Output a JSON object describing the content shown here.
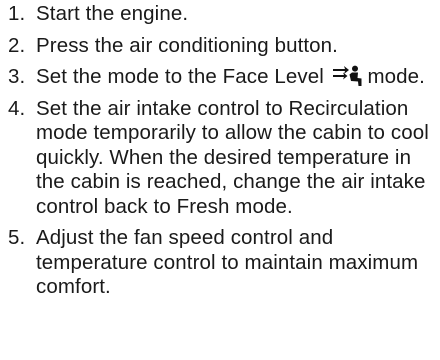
{
  "steps": [
    {
      "number": "1.",
      "text": "Start the engine."
    },
    {
      "number": "2.",
      "text": "Press the air conditioning button."
    },
    {
      "number": "3.",
      "text": "Set the mode to the Face Level",
      "text_after": "mode.",
      "icon": "face-level-mode-icon"
    },
    {
      "number": "4.",
      "text": "Set the air intake control to Recirculation mode temporarily to allow the cabin to cool quickly. When the desired temperature in the cabin is reached, change the air intake control back to Fresh mode."
    },
    {
      "number": "5.",
      "text": "Adjust the fan speed control and temperature control to maintain maximum comfort."
    }
  ]
}
